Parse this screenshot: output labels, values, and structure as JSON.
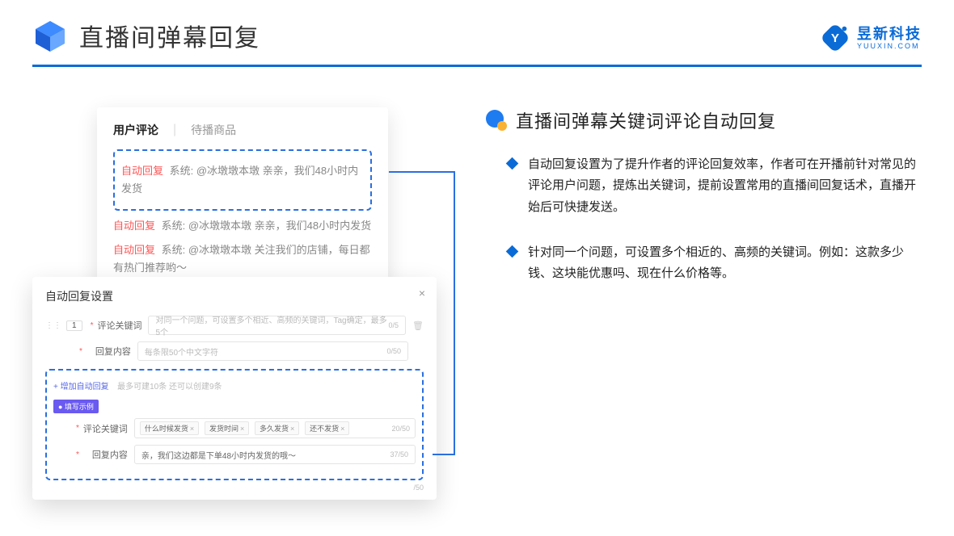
{
  "header": {
    "title": "直播间弹幕回复"
  },
  "brand": {
    "cn": "昱新科技",
    "en": "YUUXIN.COM"
  },
  "commentsCard": {
    "tab1": "用户评论",
    "tab2": "待播商品",
    "rows": {
      "r1_ar": "自动回复",
      "r1_rest": " 系统: @冰墩墩本墩 亲亲，我们48小时内发货",
      "r2_ar": "自动回复",
      "r2_rest": " 系统: @冰墩墩本墩 亲亲，我们48小时内发货",
      "r3_ar": "自动回复",
      "r3_rest": " 系统: @冰墩墩本墩 关注我们的店铺，每日都有热门推荐哟～"
    }
  },
  "settings": {
    "title": "自动回复设置",
    "num": "1",
    "kwLabel": "评论关键词",
    "kwPh": "对同一个问题，可设置多个相近、高频的关键词，Tag确定，最多5个",
    "kwCnt": "0/5",
    "contentLabel": "回复内容",
    "contentPh": "每条限50个中文字符",
    "contentCnt": "0/50",
    "addText": "+ 增加自动回复",
    "addHint": "最多可建10条 还可以创建9条",
    "exBadge": "● 填写示例",
    "exKwLabel": "评论关键词",
    "exTags": {
      "t1": "什么时候发货",
      "t2": "发货时间",
      "t3": "多久发货",
      "t4": "还不发货"
    },
    "exKwCnt": "20/50",
    "exContentLabel": "回复内容",
    "exContentVal": "亲，我们这边都是下单48小时内发货的哦～",
    "exContentCnt": "37/50",
    "trailCnt": "/50"
  },
  "right": {
    "title": "直播间弹幕关键词评论自动回复",
    "b1": "自动回复设置为了提升作者的评论回复效率，作者可在开播前针对常见的评论用户问题，提炼出关键词，提前设置常用的直播间回复话术，直播开始后可快捷发送。",
    "b2": "针对同一个问题，可设置多个相近的、高频的关键词。例如：这款多少钱、这块能优惠吗、现在什么价格等。"
  }
}
